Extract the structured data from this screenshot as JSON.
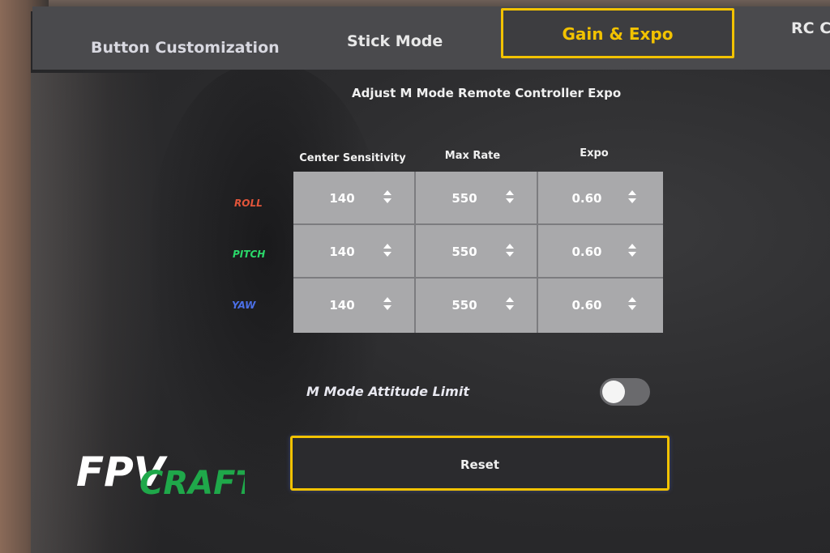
{
  "tabs": [
    {
      "label": "Button Customization",
      "active": false
    },
    {
      "label": "Stick Mode",
      "active": false
    },
    {
      "label": "Gain & Expo",
      "active": true
    },
    {
      "label": "RC Calib",
      "active": false
    }
  ],
  "page_title": "Adjust M Mode Remote Controller Expo",
  "columns": [
    "Center Sensitivity",
    "Max Rate",
    "Expo"
  ],
  "rows": [
    {
      "axis": "ROLL",
      "color": "#e2553a",
      "values": [
        "140",
        "550",
        "0.60"
      ]
    },
    {
      "axis": "PITCH",
      "color": "#2ad96a",
      "values": [
        "140",
        "550",
        "0.60"
      ]
    },
    {
      "axis": "YAW",
      "color": "#4b6fe6",
      "values": [
        "140",
        "550",
        "0.60"
      ]
    }
  ],
  "attitude_limit": {
    "label": "M Mode Attitude Limit",
    "enabled": false
  },
  "reset_label": "Reset",
  "accent_color": "#f2c200",
  "watermark": {
    "part1": "FPV",
    "part2": "CRAFT",
    "color1": "#ffffff",
    "color2": "#1fa84a"
  }
}
